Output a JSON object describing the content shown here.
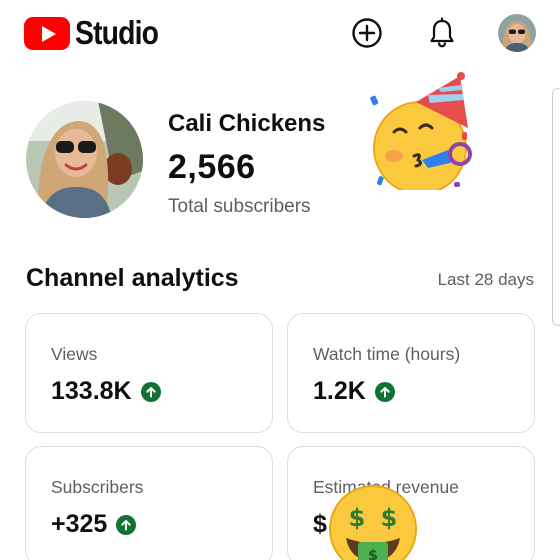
{
  "header": {
    "logo_text": "Studio",
    "brand_color": "#ff0000",
    "icons": [
      "add-circle-icon",
      "bell-icon",
      "account-avatar"
    ]
  },
  "channel": {
    "name": "Cali Chickens",
    "subscriber_count": "2,566",
    "subscriber_label": "Total subscribers"
  },
  "analytics": {
    "title": "Channel analytics",
    "period": "Last 28 days",
    "trend_color": "#137333",
    "cards": [
      {
        "label": "Views",
        "value": "133.8K",
        "trend": "up"
      },
      {
        "label": "Watch time (hours)",
        "value": "1.2K",
        "trend": "up"
      },
      {
        "label": "Subscribers",
        "value": "+325",
        "trend": "up"
      },
      {
        "label": "Estimated revenue",
        "value": "$",
        "trend": ""
      }
    ]
  },
  "stickers": [
    "partying-face-emoji",
    "money-mouth-face-emoji"
  ]
}
